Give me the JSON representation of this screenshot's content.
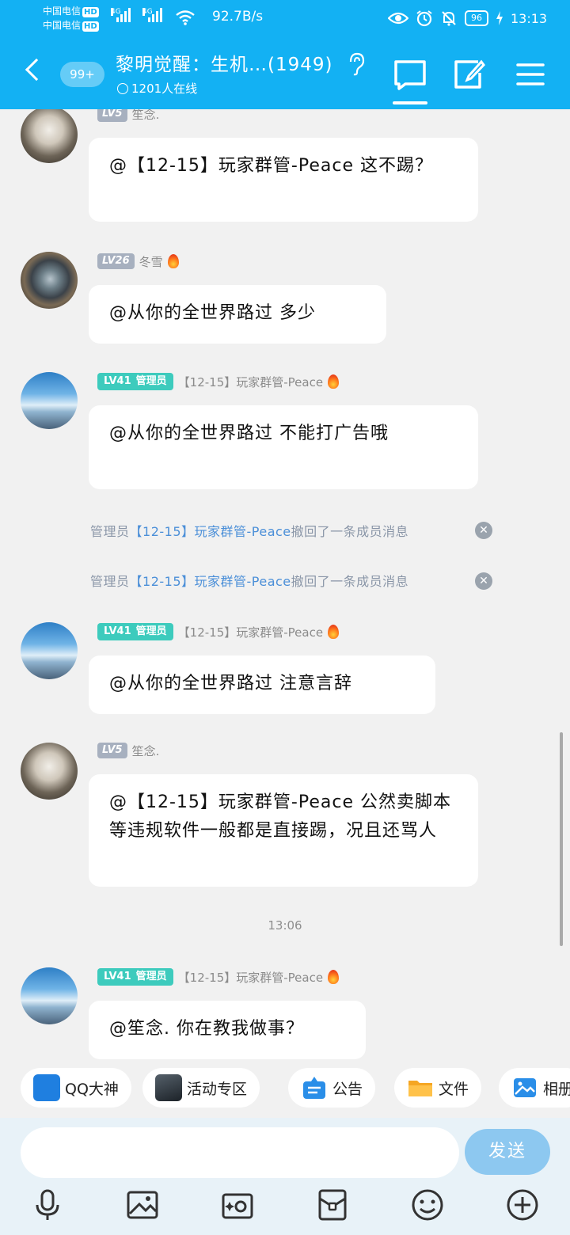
{
  "status_bar": {
    "carrier1": "中国电信",
    "carrier2": "中国电信",
    "hd": "HD",
    "net1": "4G",
    "net2": "4G",
    "speed": "92.7B/s",
    "battery": "96",
    "time": "13:13"
  },
  "header": {
    "unread_badge": "99+",
    "group_title": "黎明觉醒：生机…(1949)",
    "online_count": "1201人在线"
  },
  "messages": [
    {
      "level": "LV5",
      "nickname": "笙念.",
      "text": "@【12-15】玩家群管-Peace 这不踢？"
    },
    {
      "level": "LV26",
      "nickname": "冬雪",
      "text": "@从你的全世界路过 多少"
    },
    {
      "level": "LV41",
      "role": "管理员",
      "nickname": "【12-15】玩家群管-Peace",
      "text": "@从你的全世界路过 不能打广告哦"
    },
    {
      "level": "LV41",
      "role": "管理员",
      "nickname": "【12-15】玩家群管-Peace",
      "text": "@从你的全世界路过 注意言辞"
    },
    {
      "level": "LV5",
      "nickname": "笙念.",
      "text": "@【12-15】玩家群管-Peace 公然卖脚本等违规软件一般都是直接踢，况且还骂人"
    },
    {
      "level": "LV41",
      "role": "管理员",
      "nickname": "【12-15】玩家群管-Peace",
      "text": "@笙念. 你在教我做事？"
    }
  ],
  "system_notices": [
    {
      "prefix": "管理员",
      "name": "【12-15】玩家群管-Peace",
      "suffix": "撤回了一条成员消息"
    },
    {
      "prefix": "管理员",
      "name": "【12-15】玩家群管-Peace",
      "suffix": "撤回了一条成员消息"
    }
  ],
  "time_divider": "13:06",
  "shortcuts": [
    "QQ大神",
    "活动专区",
    "公告",
    "文件",
    "相册"
  ],
  "input": {
    "send_label": "发送"
  },
  "colors": {
    "brand": "#13b1f3",
    "admin_badge": "#3dcbbd",
    "send_button": "#8dc8f0"
  }
}
